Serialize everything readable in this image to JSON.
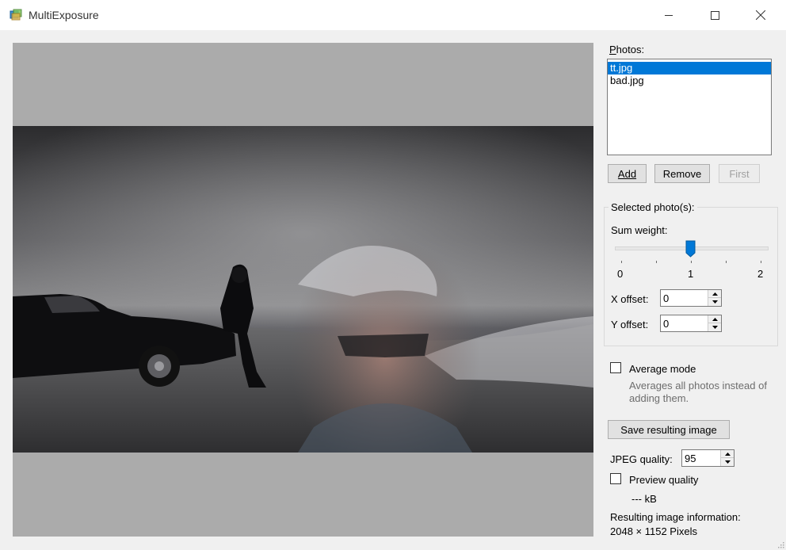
{
  "window": {
    "title": "MultiExposure"
  },
  "photos": {
    "label": "Photos:",
    "items": [
      {
        "name": "tt.jpg",
        "selected": true
      },
      {
        "name": "bad.jpg",
        "selected": false
      }
    ],
    "add_label": "Add",
    "remove_label": "Remove",
    "first_label": "First"
  },
  "selected_group": {
    "title": "Selected photo(s):",
    "sum_weight_label": "Sum weight:",
    "slider": {
      "min": 0,
      "max": 2,
      "value": 1,
      "tick_labels": [
        "0",
        "1",
        "2"
      ]
    },
    "x_offset_label": "X offset:",
    "x_offset_value": "0",
    "y_offset_label": "Y offset:",
    "y_offset_value": "0"
  },
  "average_mode": {
    "label": "Average mode",
    "checked": false,
    "description": "Averages all photos instead of adding them."
  },
  "save_label": "Save resulting image",
  "jpeg_quality": {
    "label": "JPEG quality:",
    "value": "95"
  },
  "preview_quality": {
    "label": "Preview quality",
    "checked": false
  },
  "size_text": "--- kB",
  "result_info": {
    "label": "Resulting image information:",
    "value": "2048 × 1152 Pixels"
  },
  "colors": {
    "selection": "#0078d7",
    "slider_thumb": "#0078d7",
    "canvas_bg": "#ababab"
  }
}
